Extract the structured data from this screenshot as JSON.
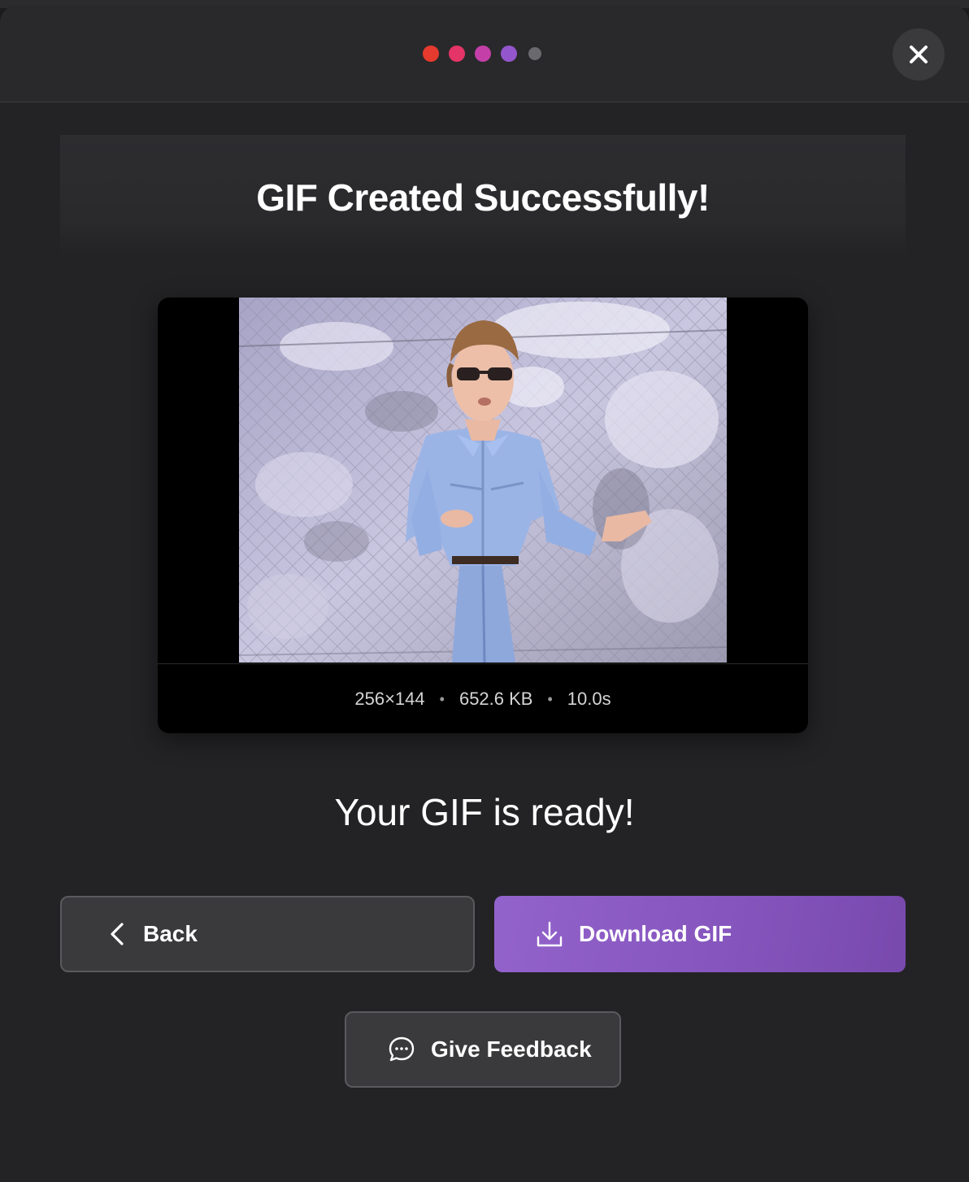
{
  "header": {
    "step_dots": [
      {
        "color": "#e63a2e",
        "state": "complete"
      },
      {
        "color": "#e53467",
        "state": "complete"
      },
      {
        "color": "#c43fa8",
        "state": "complete"
      },
      {
        "color": "#9456cc",
        "state": "current"
      },
      {
        "color": "#6a6a6e",
        "state": "pending"
      }
    ],
    "close_icon": "close-icon"
  },
  "main": {
    "title": "GIF Created Successfully!",
    "preview": {
      "dimensions": "256×144",
      "file_size": "652.6 KB",
      "duration": "10.0s",
      "separator": "•"
    },
    "ready_message": "Your GIF is ready!"
  },
  "actions": {
    "back_label": "Back",
    "back_icon": "chevron-left-icon",
    "download_label": "Download GIF",
    "download_icon": "download-icon",
    "feedback_label": "Give Feedback",
    "feedback_icon": "chat-bubble-icon"
  },
  "colors": {
    "accent": "#8656be",
    "surface": "#232325",
    "button_secondary": "#3a3a3c"
  }
}
